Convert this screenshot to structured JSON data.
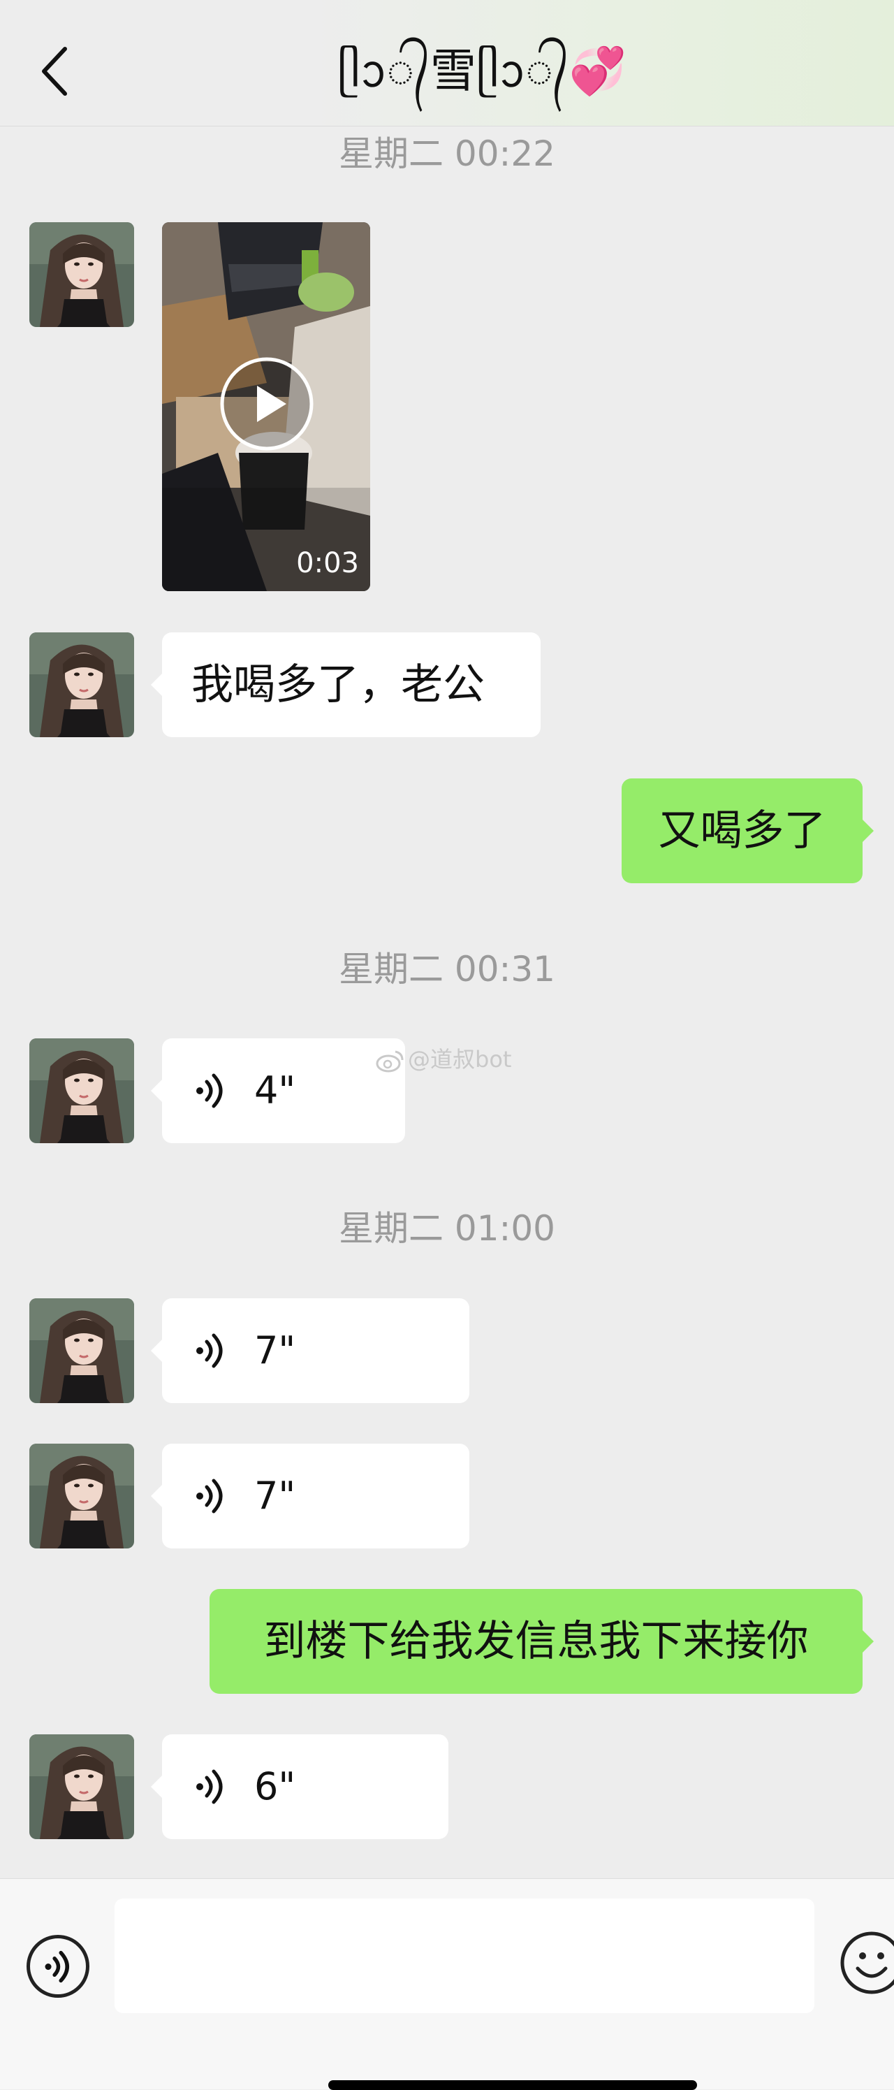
{
  "header": {
    "back_label": "Back",
    "title": "ᥫᩣ᭄雪ᥫᩣ᭄💞"
  },
  "messages": [
    {
      "kind": "timestamp",
      "text": "星期二 00:22"
    },
    {
      "kind": "video",
      "side": "left",
      "duration": "0:03"
    },
    {
      "kind": "text",
      "side": "left",
      "text": "我喝多了，老公"
    },
    {
      "kind": "text",
      "side": "right",
      "text": "又喝多了"
    },
    {
      "kind": "timestamp",
      "text": "星期二 00:31"
    },
    {
      "kind": "voice",
      "side": "left",
      "duration": "4\""
    },
    {
      "kind": "timestamp",
      "text": "星期二 01:00"
    },
    {
      "kind": "voice",
      "side": "left",
      "duration": "7\""
    },
    {
      "kind": "voice",
      "side": "left",
      "duration": "7\""
    },
    {
      "kind": "text",
      "side": "right",
      "text": "到楼下给我发信息我下来接你"
    },
    {
      "kind": "voice",
      "side": "left",
      "duration": "6\""
    }
  ],
  "watermark": "@道叔bot",
  "input_bar": {
    "voice_icon": "voice-input-icon",
    "text_value": "",
    "emoji_icon": "emoji-icon"
  },
  "colors": {
    "background": "#ededed",
    "self_bubble": "#95ec69",
    "other_bubble": "#ffffff",
    "timestamp": "#9a9a9a"
  }
}
